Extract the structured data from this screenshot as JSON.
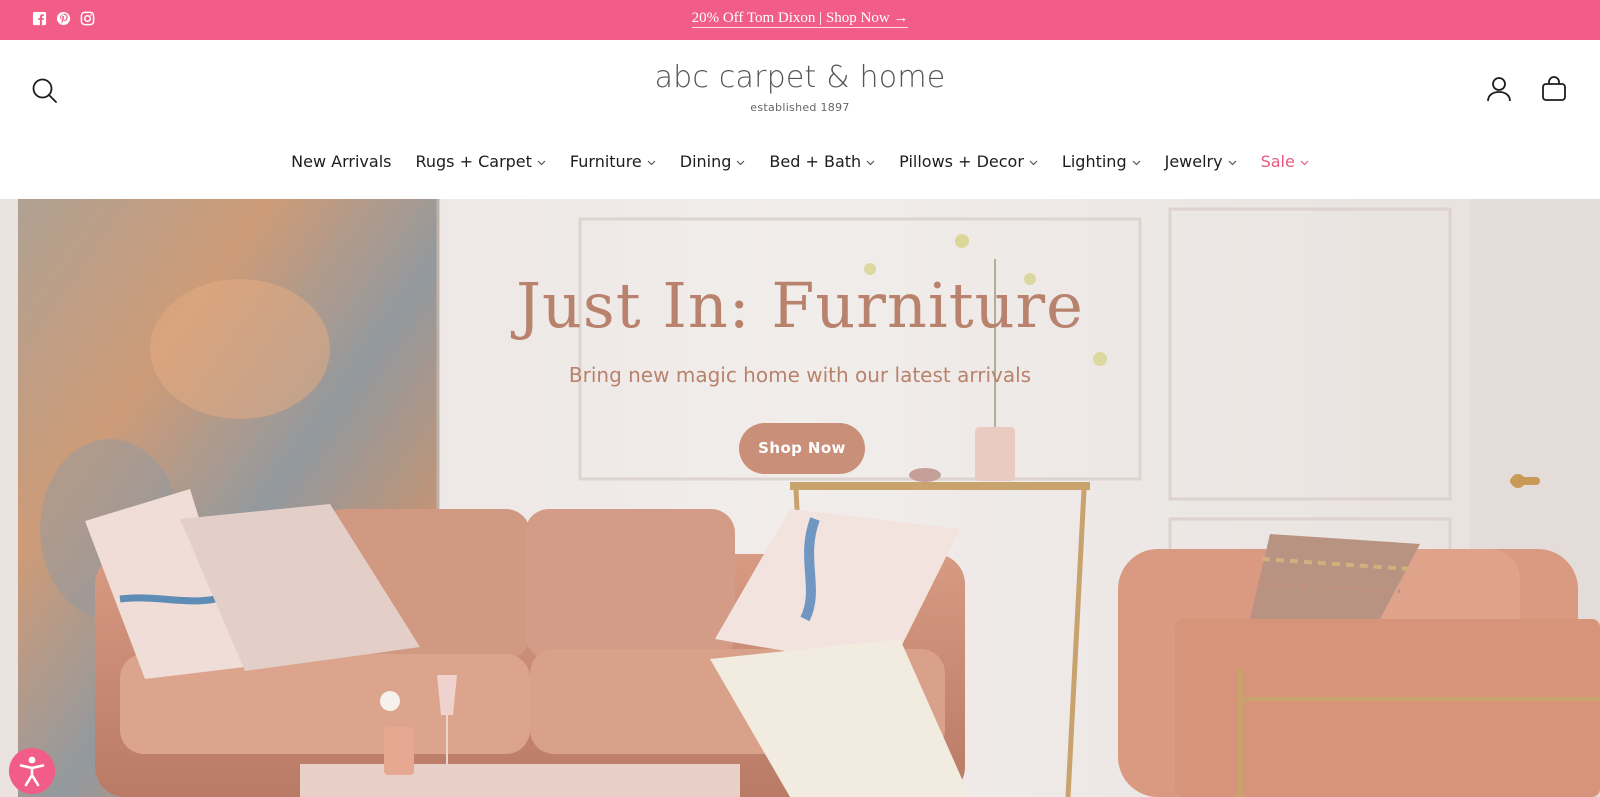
{
  "announcement": {
    "text": "20% Off Tom Dixon | Shop Now →",
    "social_icons": [
      "facebook-icon",
      "pinterest-icon",
      "instagram-icon"
    ]
  },
  "header": {
    "logo_text": "abc carpet & home",
    "logo_tagline": "established 1897",
    "icons": [
      "search-icon",
      "account-icon",
      "cart-icon"
    ]
  },
  "nav": {
    "items": [
      {
        "label": "New Arrivals",
        "dropdown": false
      },
      {
        "label": "Rugs + Carpet",
        "dropdown": true
      },
      {
        "label": "Furniture",
        "dropdown": true
      },
      {
        "label": "Dining",
        "dropdown": true
      },
      {
        "label": "Bed + Bath",
        "dropdown": true
      },
      {
        "label": "Pillows + Decor",
        "dropdown": true
      },
      {
        "label": "Lighting",
        "dropdown": true
      },
      {
        "label": "Jewelry",
        "dropdown": true
      },
      {
        "label": "Sale",
        "dropdown": true
      }
    ]
  },
  "hero": {
    "title": "Just In: Furniture",
    "subtitle": "Bring new magic home with our latest arrivals",
    "cta_label": "Shop Now"
  },
  "colors": {
    "brand_pink": "#f25d88",
    "hero_text": "#b9826d",
    "cta_bg": "#c98f78",
    "sale_text": "#e45a83"
  },
  "accessibility": {
    "icon": "accessibility-icon"
  }
}
